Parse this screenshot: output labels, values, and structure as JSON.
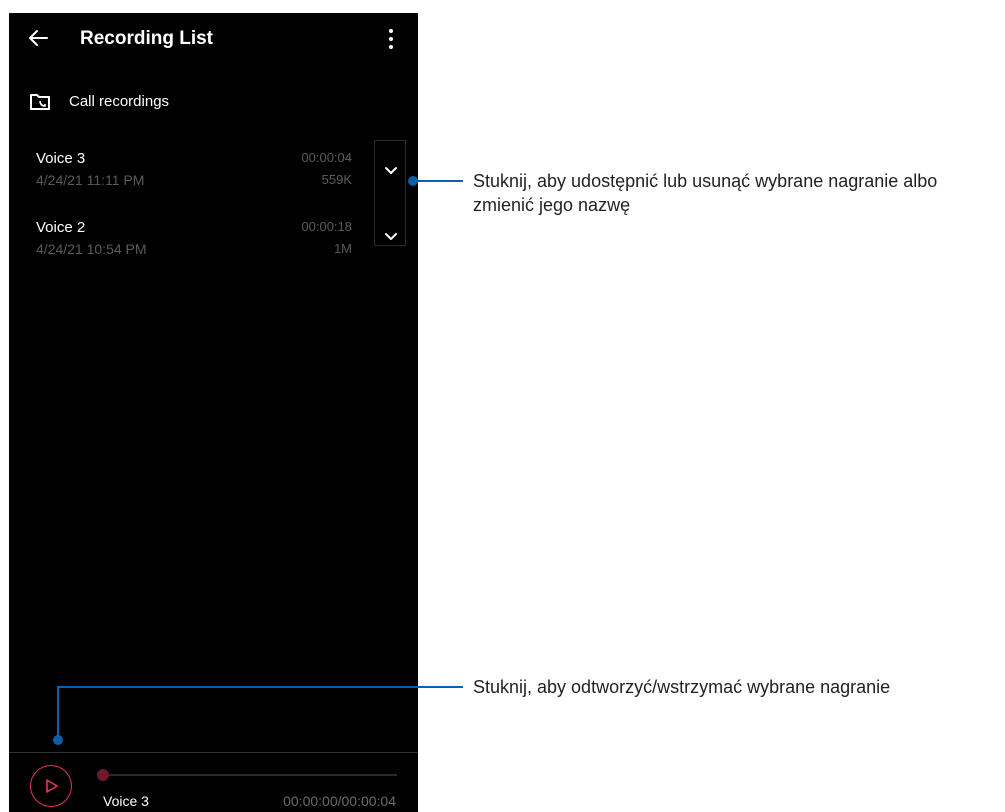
{
  "header": {
    "title": "Recording List",
    "back_icon": "back-arrow-icon",
    "menu_icon": "more-vertical-icon"
  },
  "folder": {
    "label": "Call recordings",
    "icon": "call-folder-icon"
  },
  "recordings": [
    {
      "name": "Voice 3",
      "date": "4/24/21 11:11 PM",
      "duration": "00:00:04",
      "size": "559K"
    },
    {
      "name": "Voice 2",
      "date": "4/24/21 10:54 PM",
      "duration": "00:00:18",
      "size": "1M"
    }
  ],
  "player": {
    "name": "Voice 3",
    "time": "00:00:00/00:00:04",
    "progress": 0,
    "accent_color": "#e8345a"
  },
  "annotations": {
    "expand": "Stuknij, aby udostępnić lub usunąć wybrane nagranie albo zmienić jego nazwę",
    "play": "Stuknij, aby odtworzyć/wstrzymać wybrane nagranie"
  },
  "colors": {
    "screen_bg": "#000000",
    "annotation_line": "#0b60a8",
    "secondary_text": "#5a5a5a"
  }
}
